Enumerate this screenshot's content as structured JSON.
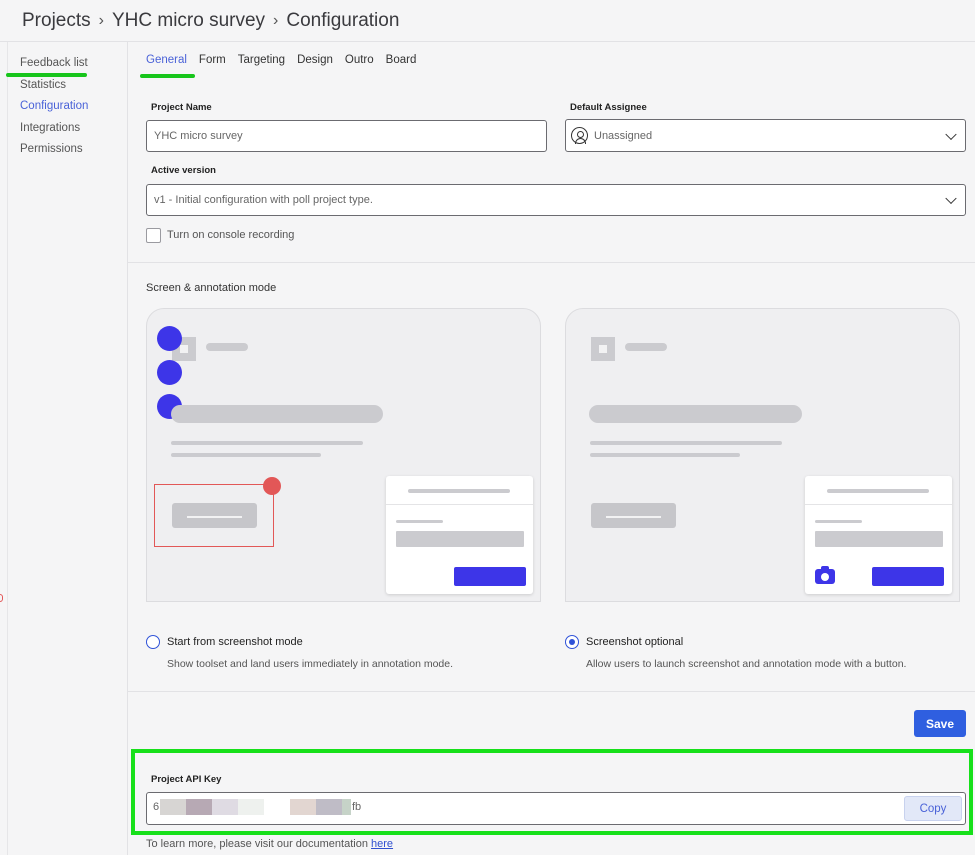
{
  "breadcrumb": {
    "items": [
      "Projects",
      "YHC micro survey",
      "Configuration"
    ],
    "separator": "›"
  },
  "sidebar": {
    "items": [
      {
        "label": "Feedback list",
        "active": false
      },
      {
        "label": "Statistics",
        "active": false
      },
      {
        "label": "Configuration",
        "active": true
      },
      {
        "label": "Integrations",
        "active": false
      },
      {
        "label": "Permissions",
        "active": false
      }
    ]
  },
  "tabs": [
    {
      "label": "General",
      "active": true
    },
    {
      "label": "Form"
    },
    {
      "label": "Targeting"
    },
    {
      "label": "Design"
    },
    {
      "label": "Outro"
    },
    {
      "label": "Board"
    }
  ],
  "general": {
    "project_name_label": "Project Name",
    "project_name_value": "YHC micro survey",
    "assignee_label": "Default Assignee",
    "assignee_value": "Unassigned",
    "active_version_label": "Active version",
    "active_version_value": "v1 - Initial configuration with poll project type.",
    "console_recording_label": "Turn on console recording",
    "console_recording_checked": false
  },
  "screen_mode": {
    "title": "Screen & annotation mode",
    "options": [
      {
        "title": "Start from screenshot mode",
        "desc": "Show toolset and land users immediately in annotation mode.",
        "selected": false
      },
      {
        "title": "Screenshot optional",
        "desc": "Allow users to launch screenshot and annotation mode with a button.",
        "selected": true
      }
    ]
  },
  "save_label": "Save",
  "api": {
    "label": "Project API Key",
    "prefix": "6",
    "suffix": "fb",
    "copy_label": "Copy"
  },
  "docs": {
    "text": "To learn more, please visit our documentation",
    "link": "here"
  },
  "colors": {
    "accent": "#2f5fe0",
    "highlight": "#17e01a",
    "illustration_blue": "#3d35e8",
    "annotation_red": "#e25757"
  }
}
